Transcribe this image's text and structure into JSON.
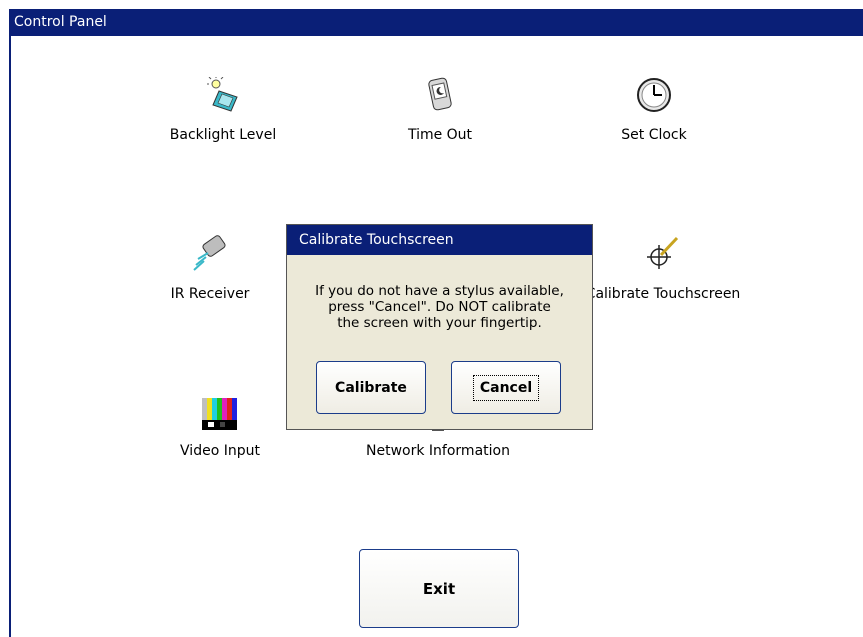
{
  "window": {
    "title": "Control Panel"
  },
  "items": [
    {
      "label": "Backlight Level",
      "icon": "backlight-icon"
    },
    {
      "label": "Time Out",
      "icon": "timeout-icon"
    },
    {
      "label": "Set Clock",
      "icon": "clock-icon"
    },
    {
      "label": "IR Receiver",
      "icon": "ir-receiver-icon"
    },
    {
      "label": "Calibrate Touchscreen",
      "icon": "crosshair-pen-icon"
    },
    {
      "label": "Video Input",
      "icon": "color-bars-icon"
    },
    {
      "label": "Network Information",
      "icon": "network-icon"
    }
  ],
  "exit_label": "Exit",
  "dialog": {
    "title": "Calibrate Touchscreen",
    "message_lines": [
      "If you do not have a stylus available,",
      "press \"Cancel\".  Do NOT calibrate",
      "the screen with your fingertip."
    ],
    "calibrate_label": "Calibrate",
    "cancel_label": "Cancel"
  },
  "colors": {
    "titlebar": "#0a1f77",
    "dialog_bg": "#ece9d8",
    "button_border": "#1b3c8a"
  }
}
